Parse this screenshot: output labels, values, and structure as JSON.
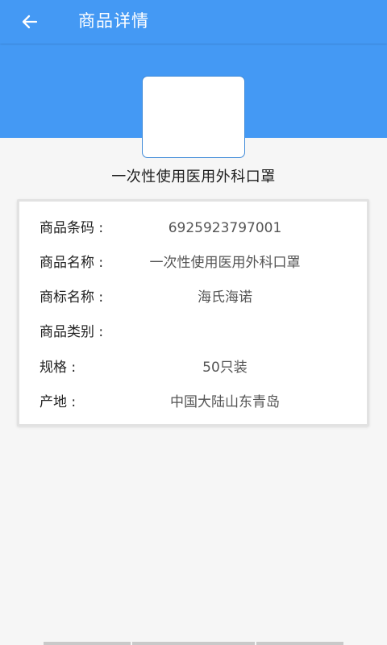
{
  "header": {
    "title": "商品详情",
    "back_icon": "arrow-left-icon"
  },
  "product": {
    "name": "一次性使用医用外科口罩"
  },
  "details": [
    {
      "label": "商品条码 :",
      "value": "6925923797001"
    },
    {
      "label": "商品名称 :",
      "value": "一次性使用医用外科口罩"
    },
    {
      "label": "商标名称 :",
      "value": "海氏海诺"
    },
    {
      "label": "商品类别 :",
      "value": ""
    },
    {
      "label": "规格 :",
      "value": "50只装"
    },
    {
      "label": "产地 :",
      "value": "中国大陆山东青岛"
    }
  ],
  "colors": {
    "primary": "#4499f4",
    "background": "#f6f6f6",
    "card_border": "#e2e2e2",
    "image_border": "#3f8ad8"
  }
}
